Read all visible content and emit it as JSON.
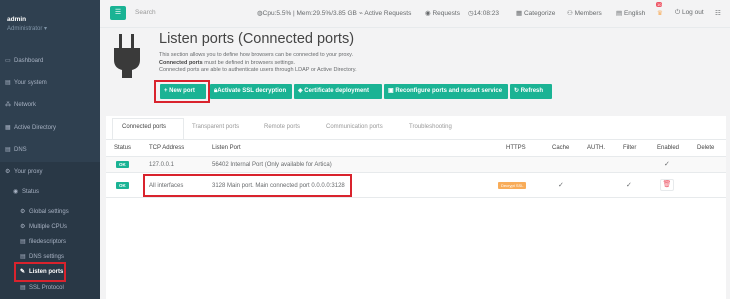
{
  "sidebar": {
    "user": "admin",
    "role": "Administrator",
    "items": [
      {
        "label": "Dashboard",
        "icon": "dashboard-icon"
      },
      {
        "label": "Your system",
        "icon": "server-icon"
      },
      {
        "label": "Network",
        "icon": "network-icon"
      },
      {
        "label": "Active Directory",
        "icon": "directory-icon"
      },
      {
        "label": "DNS",
        "icon": "dns-icon"
      },
      {
        "label": "Your proxy",
        "icon": "gear-icon"
      }
    ],
    "sub_items": [
      {
        "label": "Status"
      },
      {
        "label": "Global settings"
      },
      {
        "label": "Multiple CPUs"
      },
      {
        "label": "filedescriptors"
      },
      {
        "label": "DNS settings"
      },
      {
        "label": "Listen ports"
      },
      {
        "label": "SSL Protocol"
      }
    ]
  },
  "topbar": {
    "menu_icon": "menu-icon",
    "search_placeholder": "Search",
    "cpu": "Cpu:5.5% | Mem:29.5%/3.85 GB",
    "active_requests": "Active Requests",
    "requests": "Requests",
    "time": "14:08:23",
    "categorize": "Categorize",
    "members": "Members",
    "language": "English",
    "notif_count": "10",
    "logout": "Log out"
  },
  "header": {
    "title": "Listen ports (Connected ports)",
    "desc_line1": "This section allows you to define how browsers can be connected to your proxy.",
    "desc_line2_bold": "Connected ports",
    "desc_line2_rest": " must be defined in browsers settings.",
    "desc_line3": "Connected ports are able to authenticate users through LDAP or Active Directory."
  },
  "toolbar": {
    "new_port": "New port",
    "activate_ssl": "Activate SSL decryption",
    "cert_deploy": "Certificate deployment",
    "reconfigure": "Reconfigure ports and restart service",
    "refresh": "Refresh"
  },
  "tabs": [
    {
      "label": "Connected ports",
      "active": true
    },
    {
      "label": "Transparent ports",
      "active": false
    },
    {
      "label": "Remote ports",
      "active": false
    },
    {
      "label": "Communication ports",
      "active": false
    },
    {
      "label": "Troubleshooting",
      "active": false
    }
  ],
  "table": {
    "headers": [
      "Status",
      "TCP Address",
      "Listen Port",
      "HTTPS",
      "Cache",
      "AUTH.",
      "Filter",
      "Enabled",
      "Delete"
    ],
    "rows": [
      {
        "status": "OK",
        "address": "127.0.0.1",
        "port": "56402 Internal Port (Only available for Artica)",
        "https": "",
        "cache": "",
        "auth": "",
        "filter": "",
        "enabled": true,
        "deletable": false
      },
      {
        "status": "OK",
        "address": "All interfaces",
        "port": "3128 Main port. Main connected port 0.0.0.0:3128",
        "https": "Decrypt SSL",
        "cache": true,
        "auth": "",
        "filter": true,
        "enabled": false,
        "deletable": true
      }
    ]
  },
  "colors": {
    "accent": "#1ab394",
    "highlight": "#d9232d",
    "sidebar": "#2f4050",
    "warning": "#f8ac59",
    "danger": "#ed5565"
  }
}
